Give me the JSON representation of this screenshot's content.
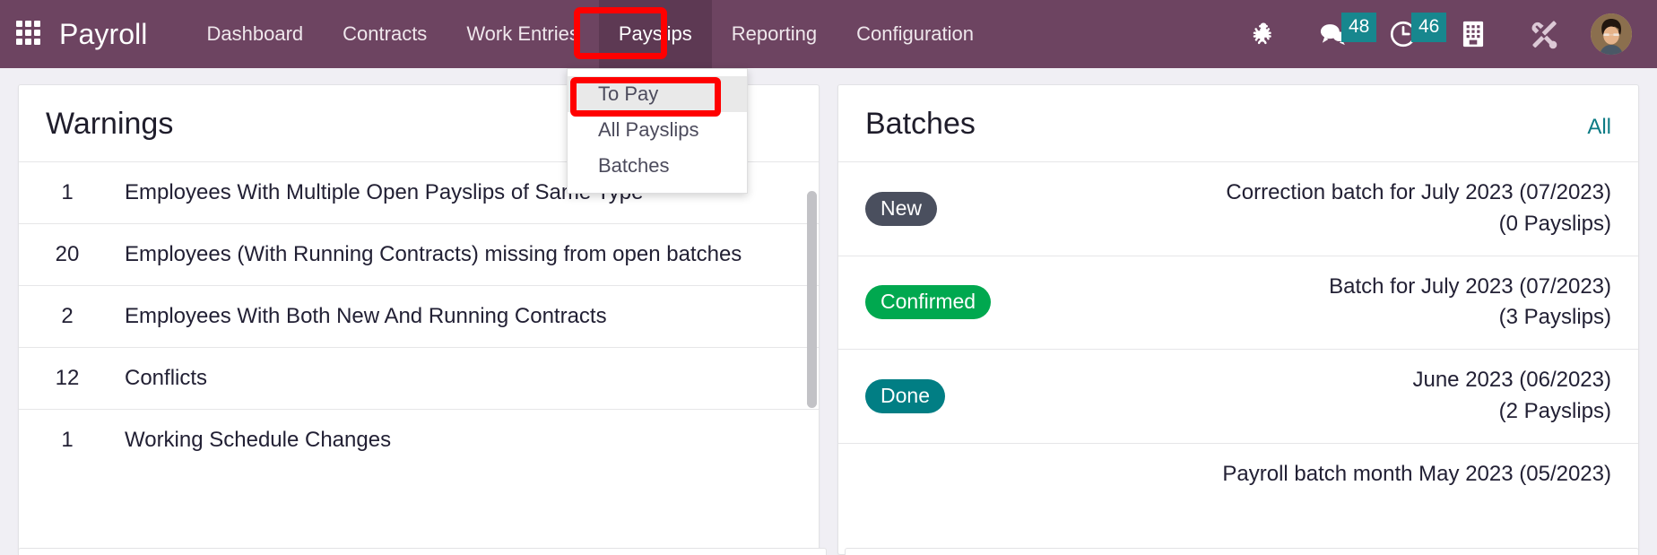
{
  "navbar": {
    "brand": "Payroll",
    "apps_icon": "apps-grid-icon",
    "menu": [
      {
        "label": "Dashboard",
        "active": false
      },
      {
        "label": "Contracts",
        "active": false
      },
      {
        "label": "Work Entries",
        "active": false
      },
      {
        "label": "Payslips",
        "active": true
      },
      {
        "label": "Reporting",
        "active": false
      },
      {
        "label": "Configuration",
        "active": false
      }
    ],
    "systray": [
      {
        "icon": "bug-icon",
        "badge": ""
      },
      {
        "icon": "messages-icon",
        "badge": "48"
      },
      {
        "icon": "activities-clock-icon",
        "badge": "46"
      },
      {
        "icon": "company-building-icon",
        "badge": ""
      },
      {
        "icon": "developer-tools-icon",
        "badge": ""
      }
    ],
    "avatar_icon": "user-avatar"
  },
  "dropdown": {
    "items": [
      {
        "label": "To Pay",
        "hovered": true
      },
      {
        "label": "All Payslips",
        "hovered": false
      },
      {
        "label": "Batches",
        "hovered": false
      }
    ]
  },
  "warnings_card": {
    "title": "Warnings",
    "rows": [
      {
        "count": "1",
        "label": "Employees With Multiple Open Payslips of Same Type"
      },
      {
        "count": "20",
        "label": "Employees (With Running Contracts) missing from open batches"
      },
      {
        "count": "2",
        "label": "Employees With Both New And Running Contracts"
      },
      {
        "count": "12",
        "label": "Conflicts"
      },
      {
        "count": "1",
        "label": "Working Schedule Changes"
      }
    ]
  },
  "batches_card": {
    "title": "Batches",
    "link": "All",
    "rows": [
      {
        "state": "New",
        "state_color": "#4a4f5e",
        "name": "Correction batch for July 2023 (07/2023)",
        "payslips": "(0 Payslips)"
      },
      {
        "state": "Confirmed",
        "state_color": "#00a84f",
        "name": "Batch for July 2023 (07/2023)",
        "payslips": "(3 Payslips)"
      },
      {
        "state": "Done",
        "state_color": "#017e84",
        "name": "June 2023 (06/2023)",
        "payslips": "(2 Payslips)"
      },
      {
        "state": "",
        "state_color": "",
        "name": "Payroll batch month May 2023 (05/2023)",
        "payslips": ""
      }
    ]
  },
  "colors": {
    "navbar_bg": "#6d4461",
    "navbar_active_bg": "#5d3953",
    "badge_bg": "#17878e",
    "highlight": "#ff0000",
    "page_bg": "#f0eff4",
    "link": "#0d7b85"
  }
}
